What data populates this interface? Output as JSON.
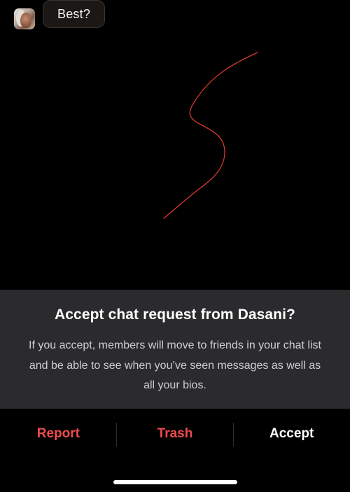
{
  "chat": {
    "message": "Best?"
  },
  "drawing": {
    "stroke_color": "#d33a2c"
  },
  "request_sheet": {
    "title": "Accept chat request from Dasani?",
    "body": "If you accept, members will move to friends in your chat list and be able to see when you’ve seen messages as well as all your bios."
  },
  "actions": {
    "report_label": "Report",
    "trash_label": "Trash",
    "accept_label": "Accept"
  },
  "colors": {
    "destructive": "#ee4b4d",
    "sheet_background": "#2b2b2d"
  }
}
